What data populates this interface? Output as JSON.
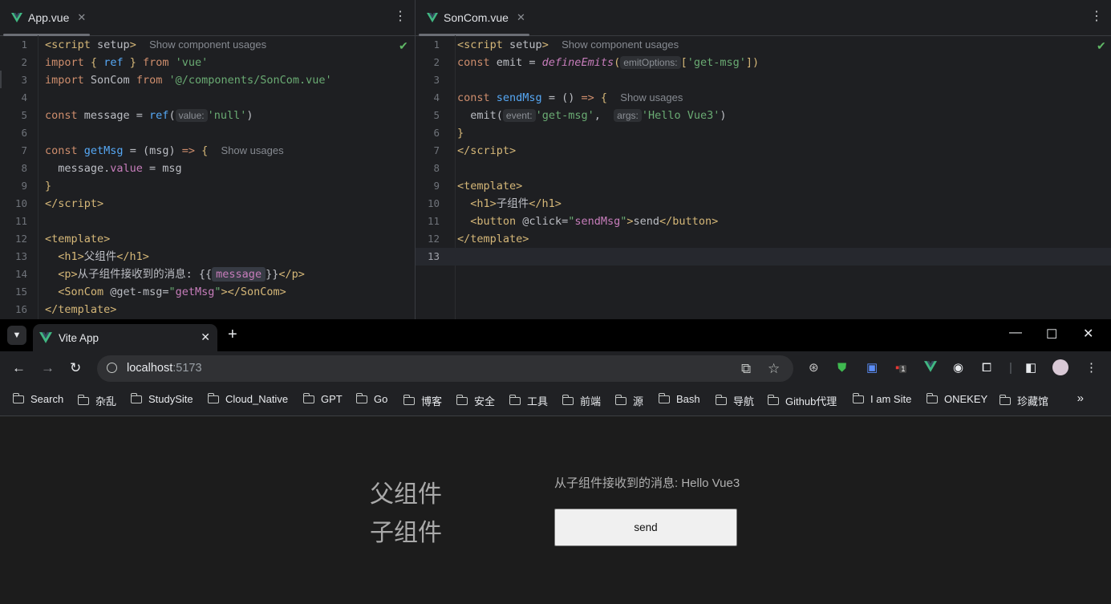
{
  "ide": {
    "left": {
      "tab": "App.vue",
      "lines": [
        "1",
        "2",
        "3",
        "4",
        "5",
        "6",
        "7",
        "8",
        "9",
        "10",
        "11",
        "12",
        "13",
        "14",
        "15",
        "16"
      ],
      "hints": {
        "show_component_usages": "Show component usages",
        "show_usages": "Show usages",
        "value_inlay": "value:"
      }
    },
    "right": {
      "tab": "SonCom.vue",
      "lines": [
        "1",
        "2",
        "3",
        "4",
        "5",
        "6",
        "7",
        "8",
        "9",
        "10",
        "11",
        "12",
        "13"
      ],
      "hints": {
        "show_component_usages": "Show component usages",
        "show_usages": "Show usages",
        "emit_options_inlay": "emitOptions:",
        "event_inlay": "event:",
        "args_inlay": "args:"
      }
    }
  },
  "browser": {
    "tab_title": "Vite App",
    "url_host": "localhost",
    "url_port": ":5173",
    "bookmarks": [
      "Search",
      "杂乱",
      "StudySite",
      "Cloud_Native",
      "GPT",
      "Go",
      "博客",
      "安全",
      "工具",
      "前端",
      "源",
      "Bash",
      "导航",
      "Github代理",
      "I am Site",
      "ONEKEY",
      "珍藏馆"
    ],
    "extension_badge": "1",
    "page": {
      "h1_parent": "父组件",
      "message_label": "从子组件接收到的消息: Hello Vue3",
      "h1_child": "子组件",
      "send_label": "send"
    }
  },
  "colors": {
    "vue_green": "#41b883",
    "editor_bg": "#1e1f22",
    "browser_bg": "#202124"
  }
}
